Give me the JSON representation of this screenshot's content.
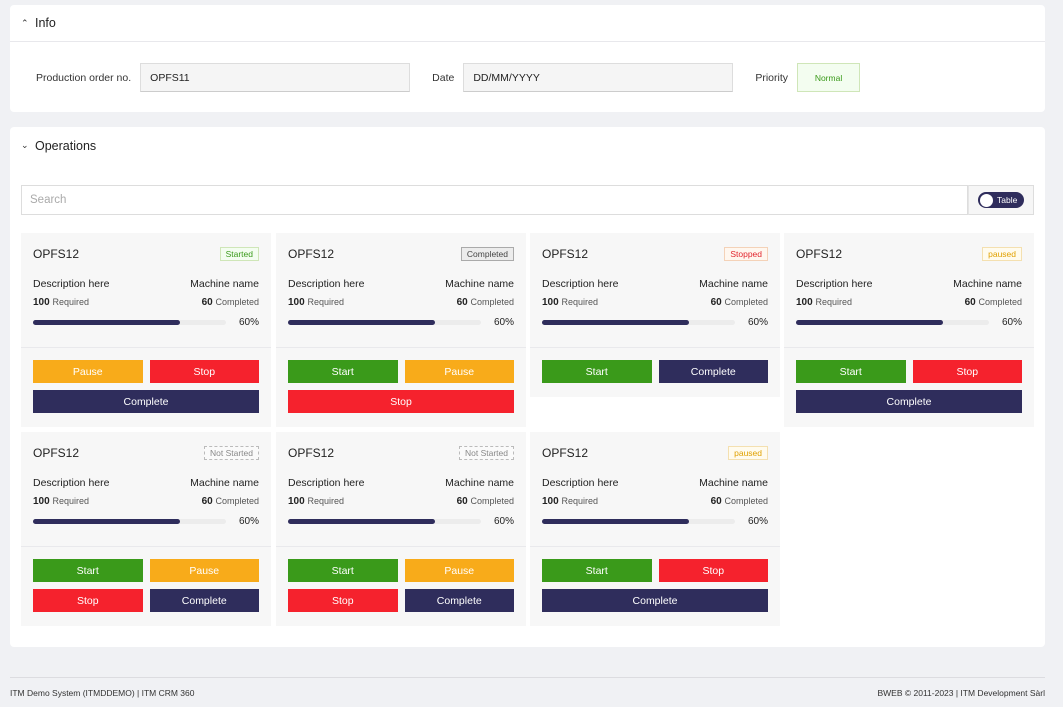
{
  "info": {
    "title": "Info",
    "order_label": "Production order no.",
    "order_value": "OPFS11",
    "date_label": "Date",
    "date_placeholder": "DD/MM/YYYY",
    "priority_label": "Priority",
    "priority_value": "Normal"
  },
  "operations": {
    "title": "Operations",
    "search_placeholder": "Search",
    "toggle_label": "Table",
    "cards": [
      {
        "title": "OPFS12",
        "status": "Started",
        "status_key": "started",
        "description": "Description here",
        "machine": "Machine name",
        "required": "100",
        "required_label": "Required",
        "completed": "60",
        "completed_label": "Completed",
        "progress_label": "60%",
        "progress_fill": 0.76,
        "buttons": [
          {
            "label": "Pause",
            "kind": "pause"
          },
          {
            "label": "Stop",
            "kind": "stop"
          },
          {
            "label": "Complete",
            "kind": "complete",
            "full": true
          }
        ]
      },
      {
        "title": "OPFS12",
        "status": "Completed",
        "status_key": "completed",
        "description": "Description here",
        "machine": "Machine name",
        "required": "100",
        "required_label": "Required",
        "completed": "60",
        "completed_label": "Completed",
        "progress_label": "60%",
        "progress_fill": 0.76,
        "buttons": [
          {
            "label": "Start",
            "kind": "start"
          },
          {
            "label": "Pause",
            "kind": "pause"
          },
          {
            "label": "Stop",
            "kind": "stop",
            "full": true
          }
        ]
      },
      {
        "title": "OPFS12",
        "status": "Stopped",
        "status_key": "stopped",
        "description": "Description here",
        "machine": "Machine name",
        "required": "100",
        "required_label": "Required",
        "completed": "60",
        "completed_label": "Completed",
        "progress_label": "60%",
        "progress_fill": 0.76,
        "buttons": [
          {
            "label": "Start",
            "kind": "start"
          },
          {
            "label": "Complete",
            "kind": "complete"
          }
        ]
      },
      {
        "title": "OPFS12",
        "status": "paused",
        "status_key": "paused",
        "description": "Description here",
        "machine": "Machine name",
        "required": "100",
        "required_label": "Required",
        "completed": "60",
        "completed_label": "Completed",
        "progress_label": "60%",
        "progress_fill": 0.76,
        "buttons": [
          {
            "label": "Start",
            "kind": "start"
          },
          {
            "label": "Stop",
            "kind": "stop"
          },
          {
            "label": "Complete",
            "kind": "complete",
            "full": true
          }
        ]
      },
      {
        "title": "OPFS12",
        "status": "Not Started",
        "status_key": "notstarted",
        "description": "Description here",
        "machine": "Machine name",
        "required": "100",
        "required_label": "Required",
        "completed": "60",
        "completed_label": "Completed",
        "progress_label": "60%",
        "progress_fill": 0.76,
        "buttons": [
          {
            "label": "Start",
            "kind": "start"
          },
          {
            "label": "Pause",
            "kind": "pause"
          },
          {
            "label": "Stop",
            "kind": "stop"
          },
          {
            "label": "Complete",
            "kind": "complete"
          }
        ]
      },
      {
        "title": "OPFS12",
        "status": "Not Started",
        "status_key": "notstarted",
        "description": "Description here",
        "machine": "Machine name",
        "required": "100",
        "required_label": "Required",
        "completed": "60",
        "completed_label": "Completed",
        "progress_label": "60%",
        "progress_fill": 0.76,
        "buttons": [
          {
            "label": "Start",
            "kind": "start"
          },
          {
            "label": "Pause",
            "kind": "pause"
          },
          {
            "label": "Stop",
            "kind": "stop"
          },
          {
            "label": "Complete",
            "kind": "complete"
          }
        ]
      },
      {
        "title": "OPFS12",
        "status": "paused",
        "status_key": "paused",
        "description": "Description here",
        "machine": "Machine name",
        "required": "100",
        "required_label": "Required",
        "completed": "60",
        "completed_label": "Completed",
        "progress_label": "60%",
        "progress_fill": 0.76,
        "buttons": [
          {
            "label": "Start",
            "kind": "start"
          },
          {
            "label": "Stop",
            "kind": "stop"
          },
          {
            "label": "Complete",
            "kind": "complete",
            "full": true
          }
        ]
      }
    ]
  },
  "footer": {
    "left": "ITM Demo System (ITMDDEMO) | ITM CRM 360",
    "right": "BWEB © 2011-2023 | ITM Development Sàrl"
  }
}
